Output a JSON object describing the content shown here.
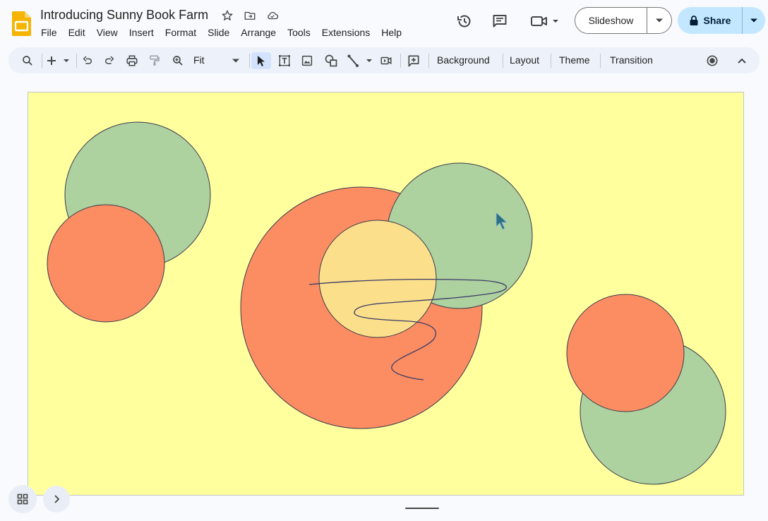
{
  "app": {
    "doc_title": "Introducing Sunny Book Farm",
    "brand_color": "#f4b400"
  },
  "menu": {
    "items": [
      "File",
      "Edit",
      "View",
      "Insert",
      "Format",
      "Slide",
      "Arrange",
      "Tools",
      "Extensions",
      "Help"
    ]
  },
  "header": {
    "slideshow_label": "Slideshow",
    "share_label": "Share",
    "share_color": "#c2e7ff"
  },
  "toolbar": {
    "zoom_label": "Fit",
    "background_label": "Background",
    "layout_label": "Layout",
    "theme_label": "Theme",
    "transition_label": "Transition",
    "icons": [
      "search-icon",
      "new-slide-icon",
      "undo-icon",
      "redo-icon",
      "print-icon",
      "paint-format-icon",
      "zoom-icon",
      "select-icon",
      "text-box-icon",
      "image-icon",
      "shape-icon",
      "line-icon",
      "video-icon",
      "comment-add-icon",
      "record-icon",
      "collapse-icon"
    ]
  },
  "slide": {
    "background_color": "#ffff9e",
    "shape_colors": {
      "green": "#add19f",
      "orange": "#fc8d62",
      "yellow": "#fbdf8b",
      "outline": "#3b3b4d"
    }
  }
}
